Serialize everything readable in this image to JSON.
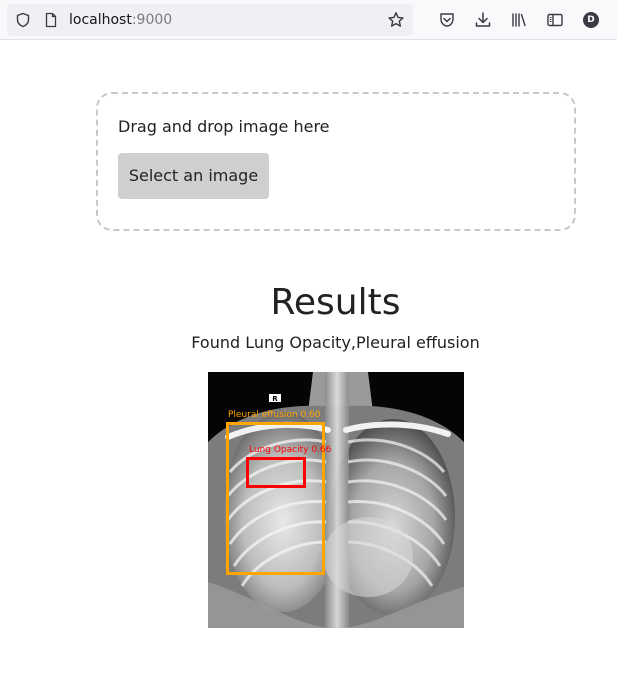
{
  "browser": {
    "url_host": "localhost",
    "url_port": ":9000",
    "profile_initial": "D",
    "icons": [
      "shield-icon",
      "page-icon",
      "star-icon",
      "pocket-icon",
      "download-icon",
      "library-icon",
      "sidebar-icon"
    ]
  },
  "upload": {
    "drop_text": "Drag and drop image here",
    "select_label": "Select an image"
  },
  "results": {
    "title": "Results",
    "summary": "Found Lung Opacity,Pleural effusion",
    "image_marker": "R",
    "detections": [
      {
        "label": "Pleural effusion 0.60",
        "color": "#ffa500"
      },
      {
        "label": "Lung Opacity 0.66",
        "color": "#ff0000"
      }
    ]
  },
  "colors": {
    "button_bg": "#cfcfcf",
    "dropzone_border": "#c8c8c8",
    "pleural_box": "#ffa500",
    "opacity_box": "#ff0000"
  }
}
